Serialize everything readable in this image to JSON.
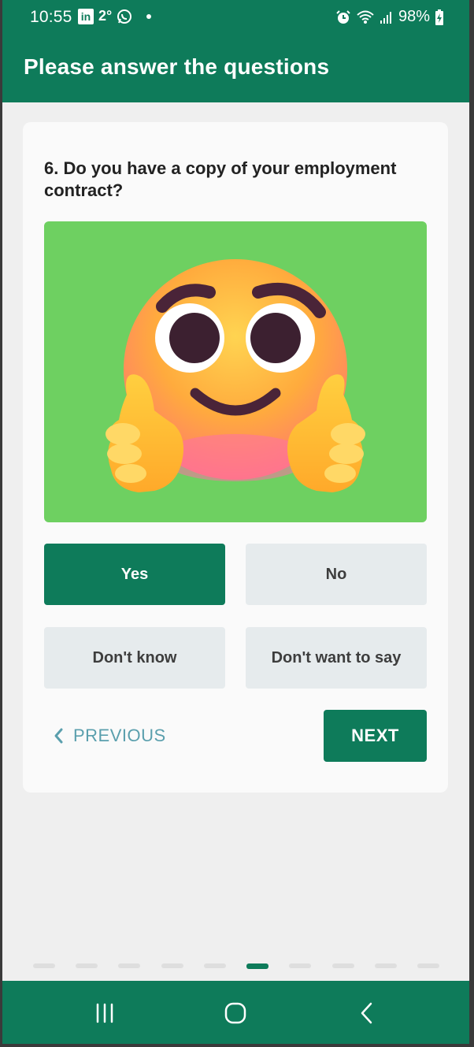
{
  "status_bar": {
    "time": "10:55",
    "linkedin_label": "in",
    "temperature": "2°",
    "battery": "98%"
  },
  "app_bar": {
    "title": "Please answer the questions"
  },
  "question": {
    "text": "6. Do you have a copy of your employment contract?",
    "image": "thumbs-up-smiling-face-emoji"
  },
  "answers": [
    {
      "label": "Yes",
      "selected": true
    },
    {
      "label": "No",
      "selected": false
    },
    {
      "label": "Don't know",
      "selected": false
    },
    {
      "label": "Don't want to say",
      "selected": false
    }
  ],
  "navigation": {
    "previous_label": "PREVIOUS",
    "next_label": "NEXT"
  },
  "pager": {
    "total": 10,
    "current": 6
  },
  "colors": {
    "primary": "#0e7b5a",
    "image_background": "#6ed061",
    "answer_unselected": "#e6ebed",
    "previous_text": "#5a9fad",
    "background": "#efefef"
  }
}
